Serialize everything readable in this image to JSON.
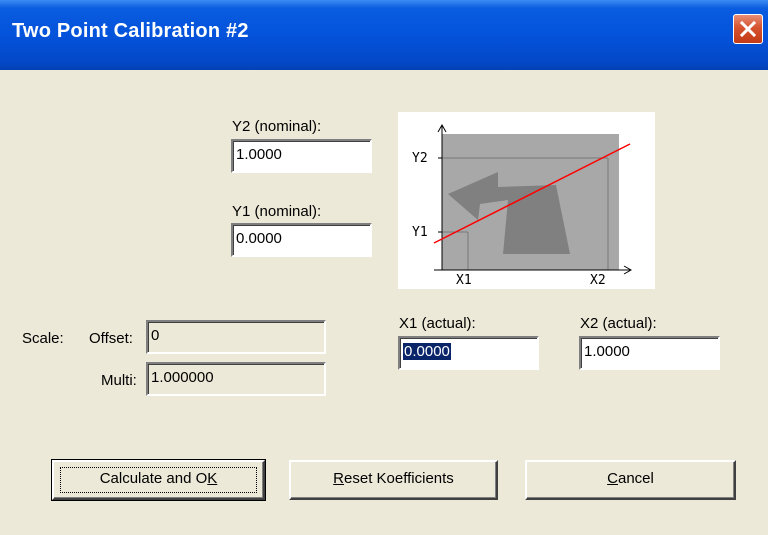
{
  "window": {
    "title": "Two Point Calibration #2",
    "close_icon": "close-x-icon",
    "titlebar_color": "#0453DB"
  },
  "y2": {
    "label": "Y2 (nominal):",
    "value": "1.0000"
  },
  "y1": {
    "label": "Y1 (nominal):",
    "value": "0.0000"
  },
  "x1": {
    "label": "X1 (actual):",
    "value": "0.0000"
  },
  "x2": {
    "label": "X2 (actual):",
    "value": "1.0000"
  },
  "scale": {
    "label": "Scale:",
    "offset_label": "Offset:",
    "offset_value": "0",
    "multi_label": "Multi:",
    "multi_value": "1.000000"
  },
  "diagram": {
    "y2_label": "Y2",
    "y1_label": "Y1",
    "x1_label": "X1",
    "x2_label": "X2",
    "line_color": "#FF0000"
  },
  "buttons": {
    "calculate": {
      "pre": "Calculate and O",
      "mnemonic": "K",
      "post": ""
    },
    "reset": {
      "pre": "",
      "mnemonic": "R",
      "post": "eset Koefficients"
    },
    "cancel": {
      "pre": "",
      "mnemonic": "C",
      "post": "ancel"
    }
  }
}
